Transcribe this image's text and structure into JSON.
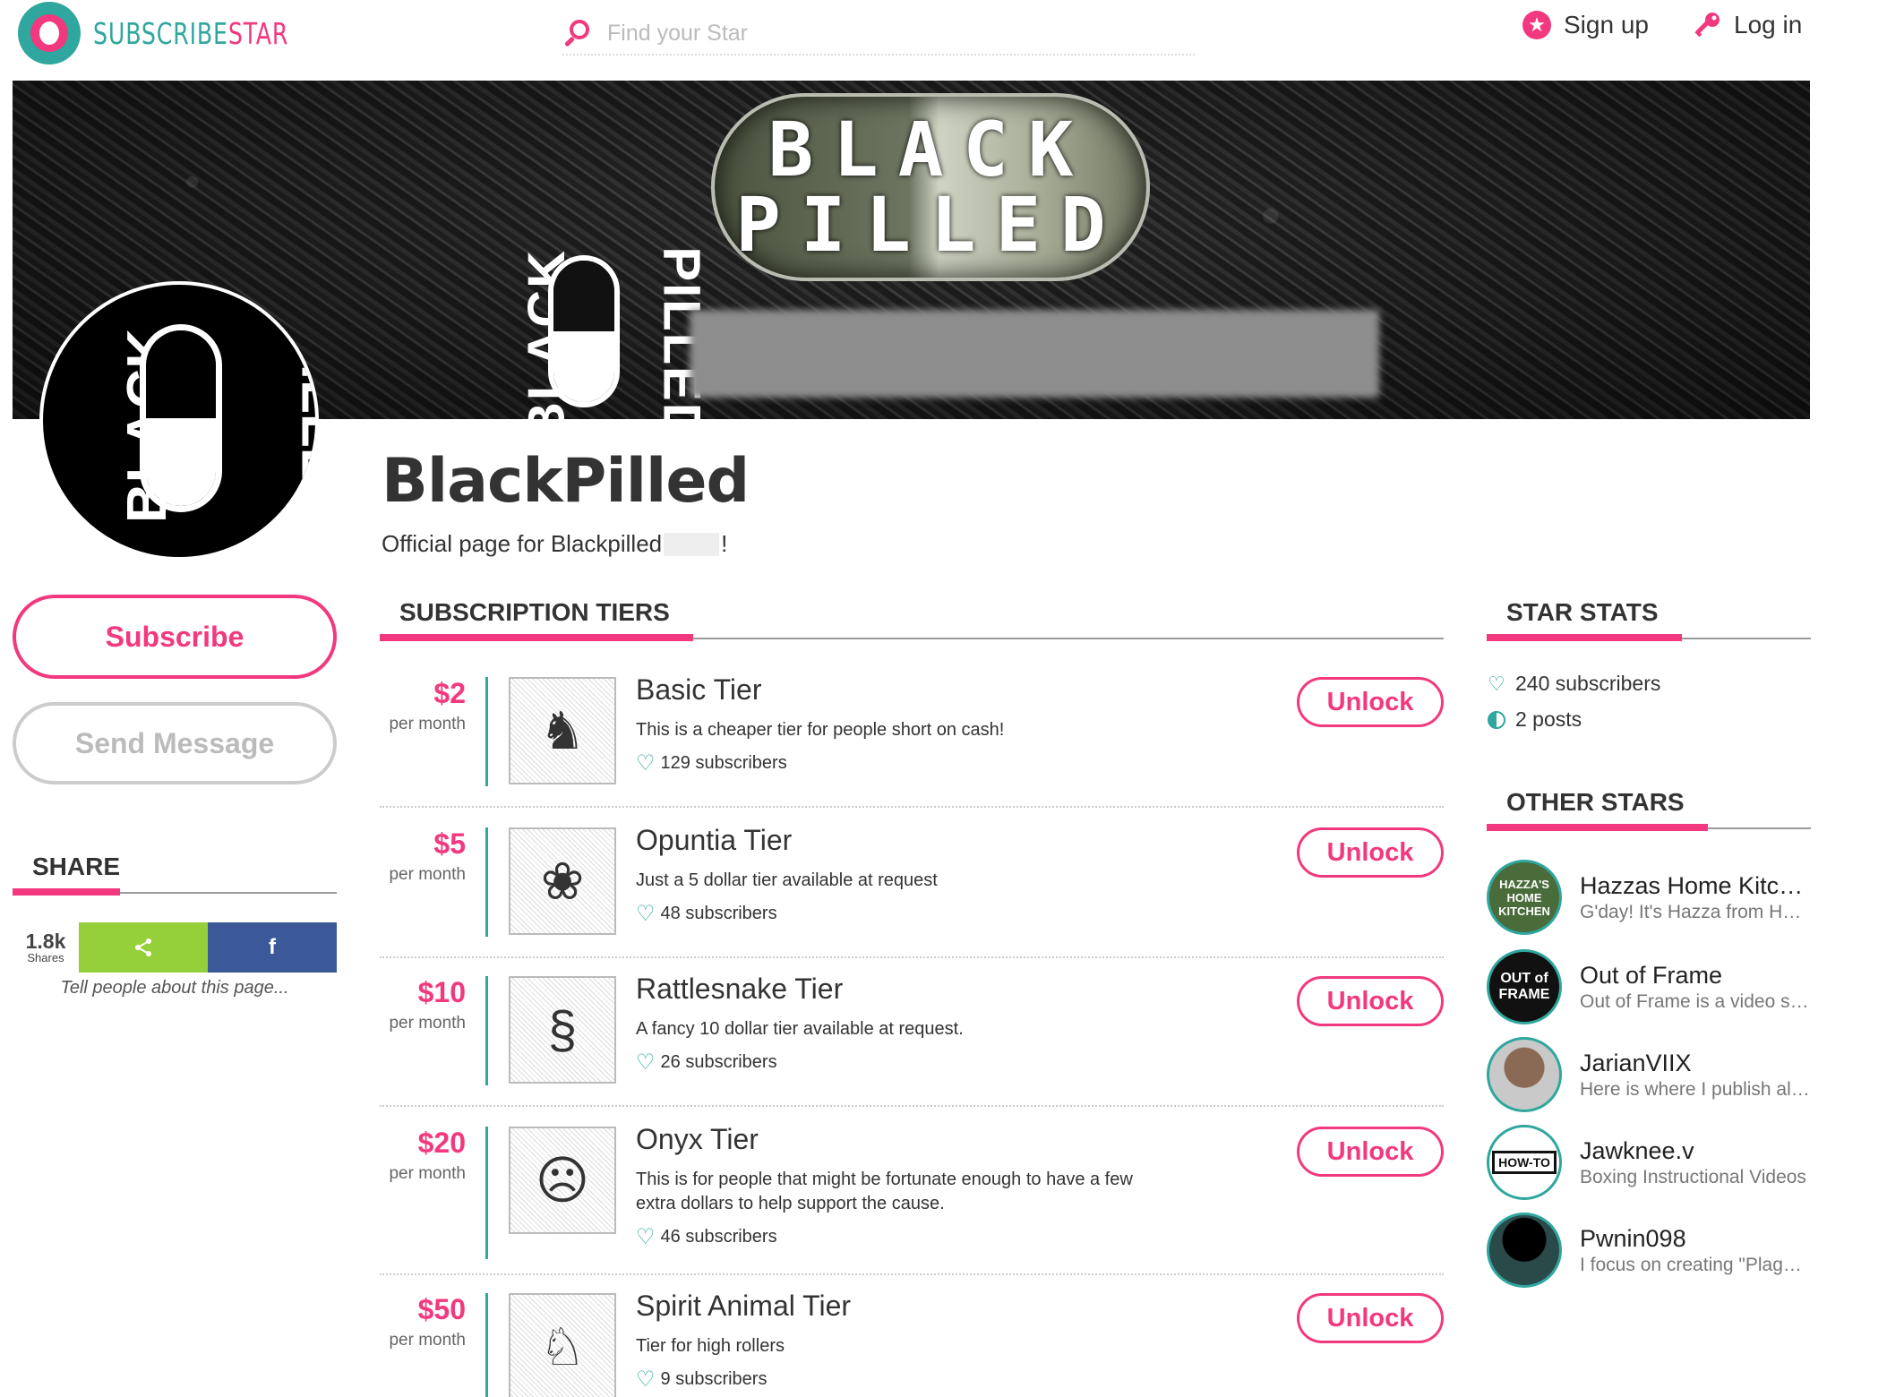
{
  "brand": {
    "name_part1": "SUBSCRIBE",
    "name_part2": "STAR",
    "teal": "#2fa79e",
    "pink": "#f2387f"
  },
  "search": {
    "placeholder": "Find your Star"
  },
  "nav": {
    "signup": "Sign up",
    "login": "Log in"
  },
  "banner": {
    "line1": "BLACK",
    "line2": "PILLED",
    "logo_left": "BLACK",
    "logo_right": "PILLED"
  },
  "avatar": {
    "left": "BLACK",
    "right": "PILLED"
  },
  "profile": {
    "title": "BlackPilled",
    "desc_start": "Official page for Blackpilled",
    "desc_end": "!"
  },
  "actions": {
    "subscribe": "Subscribe",
    "send_message": "Send Message"
  },
  "share": {
    "heading": "SHARE",
    "count": "1.8k",
    "count_label": "Shares",
    "facebook": "f",
    "note": "Tell people about this page..."
  },
  "tiers_heading": "SUBSCRIPTION TIERS",
  "tiers": [
    {
      "price": "$2",
      "per": "per month",
      "name": "Basic Tier",
      "desc": "This is a cheaper tier for people short on cash!",
      "subs": "129 subscribers",
      "unlock": "Unlock",
      "icon": "rider-illustration"
    },
    {
      "price": "$5",
      "per": "per month",
      "name": "Opuntia Tier",
      "desc": "Just a 5 dollar tier available at request",
      "subs": "48 subscribers",
      "unlock": "Unlock",
      "icon": "cactus-illustration"
    },
    {
      "price": "$10",
      "per": "per month",
      "name": "Rattlesnake Tier",
      "desc": "A fancy 10 dollar tier available at request.",
      "subs": "26 subscribers",
      "unlock": "Unlock",
      "icon": "snake-illustration"
    },
    {
      "price": "$20",
      "per": "per month",
      "name": "Onyx Tier",
      "desc": "This is for people that might be fortunate enough to have a few extra dollars to help support the cause.",
      "subs": "46 subscribers",
      "unlock": "Unlock",
      "icon": "frog-illustration"
    },
    {
      "price": "$50",
      "per": "per month",
      "name": "Spirit Animal Tier",
      "desc": "Tier for high rollers",
      "subs": "9 subscribers",
      "unlock": "Unlock",
      "icon": "fox-illustration"
    }
  ],
  "stats": {
    "heading": "STAR STATS",
    "subscribers": "240 subscribers",
    "posts": "2 posts"
  },
  "other_stars": {
    "heading": "OTHER STARS",
    "items": [
      {
        "name": "Hazzas Home Kitchen",
        "desc": "G'day! It's Hazza from Hazzas Home Kitchen",
        "avatar_text": "HAZZA'S HOME KITCHEN",
        "avatar_color": "#4a6b3a"
      },
      {
        "name": "Out of Frame",
        "desc": "Out of Frame is a video series",
        "avatar_text": "OUT of FRAME",
        "avatar_color": "#111111"
      },
      {
        "name": "JarianVIIX",
        "desc": "Here is where I publish all my content",
        "avatar_text": "",
        "avatar_color": "#6b5444"
      },
      {
        "name": "Jawknee.v",
        "desc": "Boxing Instructional Videos",
        "avatar_text": "HOW-TO",
        "avatar_color": "#ffffff"
      },
      {
        "name": "Pwnin098",
        "desc": "I focus on creating \"Plague\" content",
        "avatar_text": "",
        "avatar_color": "#1c2a2a"
      }
    ]
  }
}
